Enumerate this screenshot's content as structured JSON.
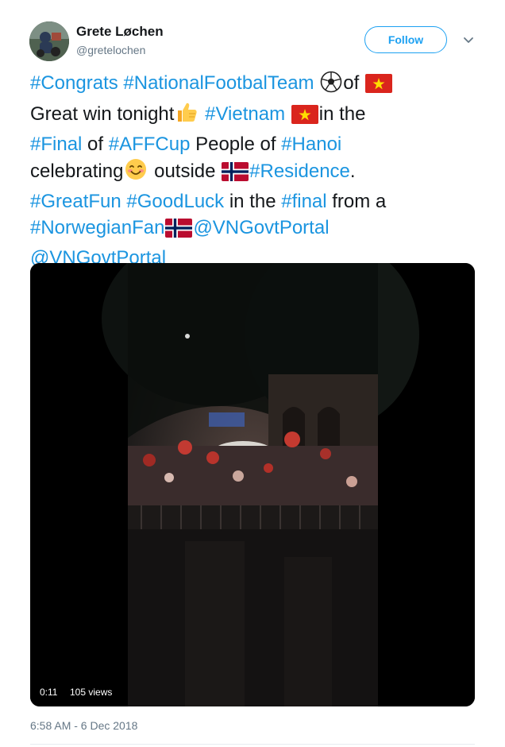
{
  "author": {
    "name": "Grete Løchen",
    "handle": "@gretelochen"
  },
  "follow_label": "Follow",
  "tweet": {
    "l1": {
      "t1": "#Congrats",
      "t2": " ",
      "t3": "#NationalFootbalTeam",
      "t4": "of"
    },
    "l2": {
      "t1": "Great win tonight",
      "t2": " ",
      "t3": "#Vietnam",
      "t4": "in the"
    },
    "l3": {
      "t1": "#Final",
      "t2": " of ",
      "t3": "#AFFCup",
      "t4": " People of ",
      "t5": "#Hanoi"
    },
    "l4": {
      "t1": "celebrating",
      "t2": " outside ",
      "t3": "#Residence",
      "t4": "."
    },
    "l5": {
      "t1": "#GreatFun",
      "t2": " ",
      "t3": "#GoodLuck",
      "t4": " in the ",
      "t5": "#final",
      "t6": " from a"
    },
    "l6": {
      "t1": "#NorwegianFan",
      "t2": "@VNGovtPortal"
    },
    "l7": {
      "t1": "@VNGovtPortal"
    }
  },
  "video": {
    "duration": "0:11",
    "views": "105 views"
  },
  "timestamp": "6:58 AM - 6 Dec 2018",
  "colors": {
    "link": "#1b95e0",
    "follow": "#1da1f2",
    "text": "#14171a",
    "muted": "#657786"
  },
  "icons": [
    "soccer-ball-icon",
    "vietnam-flag-icon",
    "thumbs-up-icon",
    "smiling-face-icon",
    "norway-flag-icon",
    "chevron-down-icon"
  ]
}
